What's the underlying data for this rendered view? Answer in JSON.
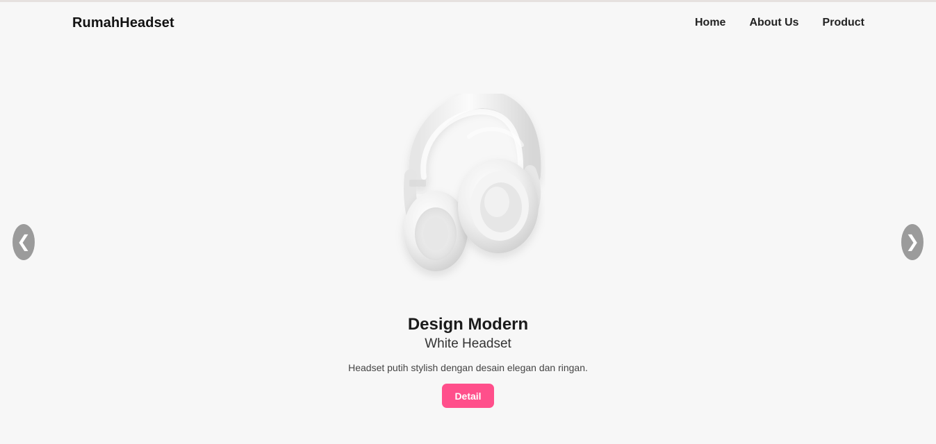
{
  "brand": {
    "name": "RumahHeadset"
  },
  "nav": {
    "items": [
      {
        "label": "Home"
      },
      {
        "label": "About Us"
      },
      {
        "label": "Product"
      }
    ]
  },
  "carousel": {
    "prev_icon": "chevron-left-icon",
    "next_icon": "chevron-right-icon",
    "prev_glyph": "❮",
    "next_glyph": "❯"
  },
  "slide": {
    "title": "Design Modern",
    "subtitle": "White Headset",
    "description": "Headset putih stylish dengan desain elegan dan ringan.",
    "button_label": "Detail"
  },
  "colors": {
    "background": "#f7f7f7",
    "accent": "#ff4f8b",
    "arrow_bg": "#9b9b9b",
    "text_dark": "#1b1b1b"
  }
}
